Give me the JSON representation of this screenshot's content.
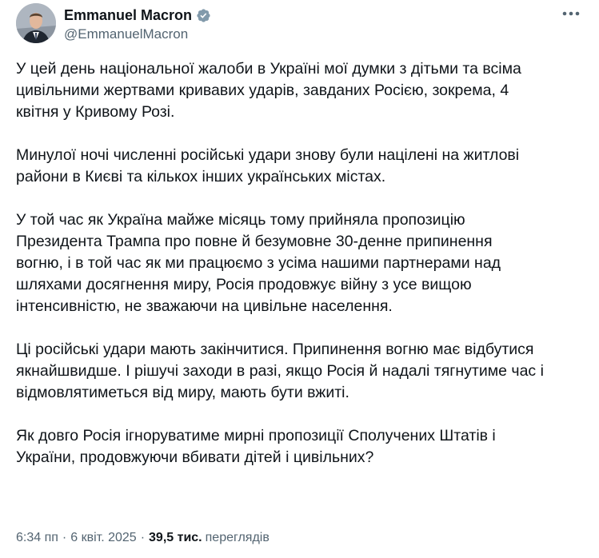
{
  "author": {
    "display_name": "Emmanuel Macron",
    "handle": "@EmmanuelMacron",
    "verified_icon": "verified-badge-gray",
    "badge_color": "#829aab"
  },
  "tweet": {
    "paragraphs": [
      "У цей день національної жалоби в Україні мої думки з дітьми та всіма\nцивільними жертвами кривавих ударів, завданих Росією, зокрема, 4\nквітня у Кривому Розі.",
      "Минулої ночі численні російські удари знову були націлені на житлові\nрайони в Києві та кількох інших українських містах.",
      "У той час як Україна майже місяць тому прийняла пропозицію\nПрезидента Трампа про повне й безумовне 30-денне припинення\nвогню, і в той час як ми працюємо з усіма нашими партнерами над\nшляхами досягнення миру, Росія продовжує війну з усе вищою\nінтенсивністю, не зважаючи на цивільне населення.",
      "Ці російські удари мають закінчитися. Припинення вогню має відбутися\nякнайшвидше. І рішучі заходи в разі, якщо Росія й надалі тягнутиме час і\nвідмовлятиметься від миру, мають бути вжиті.",
      "Як довго Росія ігноруватиме мирні пропозиції Сполучених Штатів і\nУкраїни, продовжуючи вбивати дітей і цивільних?"
    ]
  },
  "meta": {
    "time": "6:34 пп",
    "separator": "·",
    "date": "6 квіт. 2025",
    "views_count": "39,5 тис.",
    "views_label": "переглядів"
  },
  "icons": {
    "more": "more-horizontal-icon"
  },
  "colors": {
    "text_primary": "#0f1419",
    "text_secondary": "#536471"
  }
}
